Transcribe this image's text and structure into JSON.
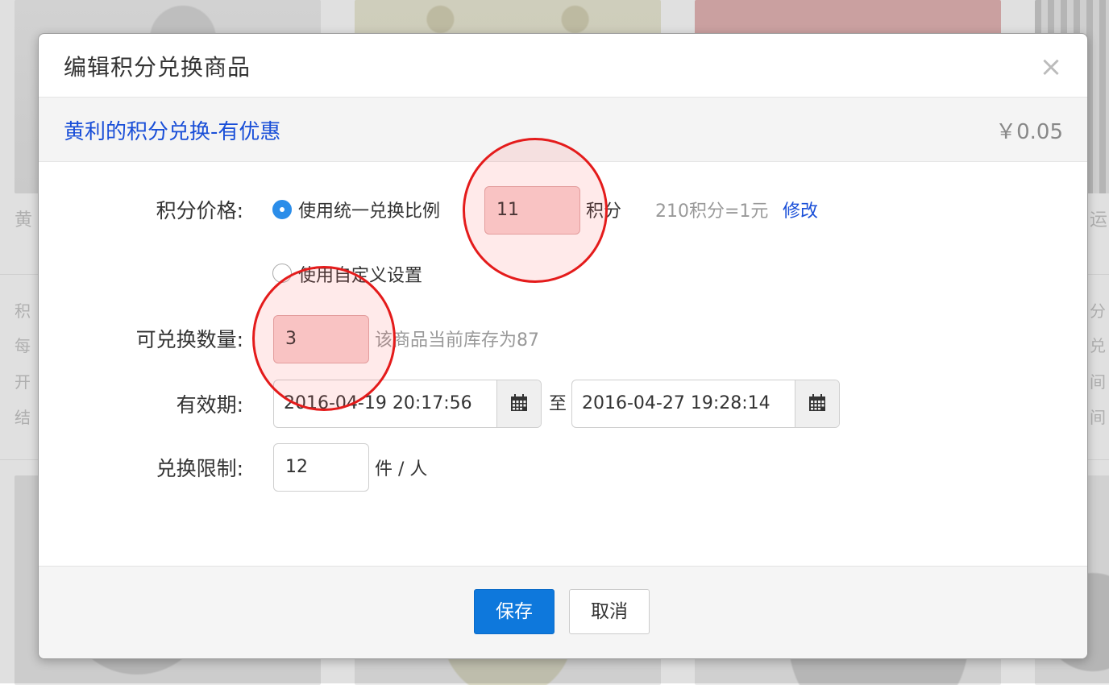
{
  "background": {
    "fragments": [
      "黄",
      "积",
      "每",
      "开",
      "结",
      "运",
      "分",
      "兑",
      "间",
      "间"
    ]
  },
  "modal": {
    "title": "编辑积分兑换商品",
    "close_glyph": "×",
    "product": {
      "name": "黄利的积分兑换-有优惠",
      "price": "￥0.05"
    },
    "points_price": {
      "label": "积分价格:",
      "option_unified": "使用统一兑换比例",
      "value": "11",
      "unit": "积分",
      "ratio": "210积分=1元",
      "modify_link": "修改",
      "option_custom": "使用自定义设置"
    },
    "quantity": {
      "label": "可兑换数量:",
      "value": "3",
      "stock_hint": "该商品当前库存为87"
    },
    "validity": {
      "label": "有效期:",
      "start": "2016-04-19 20:17:56",
      "separator": "至",
      "end": "2016-04-27 19:28:14"
    },
    "limit": {
      "label": "兑换限制:",
      "value": "12",
      "unit": "件 / 人"
    },
    "footer": {
      "save": "保存",
      "cancel": "取消"
    }
  },
  "colors": {
    "accent": "#0e78dc",
    "link": "#1a4fd8",
    "highlight_fill": "#f9d3d3",
    "marker": "#e41b1b"
  },
  "icons": [
    "close-icon",
    "radio-checked",
    "radio-unchecked",
    "calendar-icon"
  ]
}
